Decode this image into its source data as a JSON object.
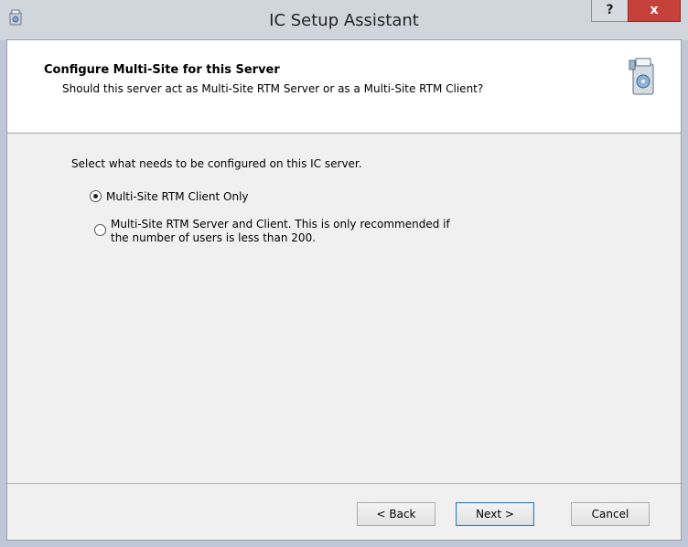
{
  "window": {
    "title": "IC Setup Assistant",
    "help_label": "?",
    "close_label": "x"
  },
  "header": {
    "title": "Configure Multi-Site for this Server",
    "subtitle": "Should this server act as Multi-Site RTM Server or as a Multi-Site RTM Client?"
  },
  "body": {
    "prompt": "Select what needs to be configured on this IC server.",
    "options": [
      {
        "label_line1": "Multi-Site RTM Client Only",
        "label_line2": "",
        "selected": true
      },
      {
        "label_line1": "Multi-Site RTM Server and Client. This is only recommended if",
        "label_line2": "the number of users is less than 200.",
        "selected": false
      }
    ]
  },
  "buttons": {
    "back": "< Back",
    "next": "Next >",
    "cancel": "Cancel"
  },
  "colors": {
    "close_button": "#c6413a",
    "default_button_border": "#3c7fb1"
  }
}
